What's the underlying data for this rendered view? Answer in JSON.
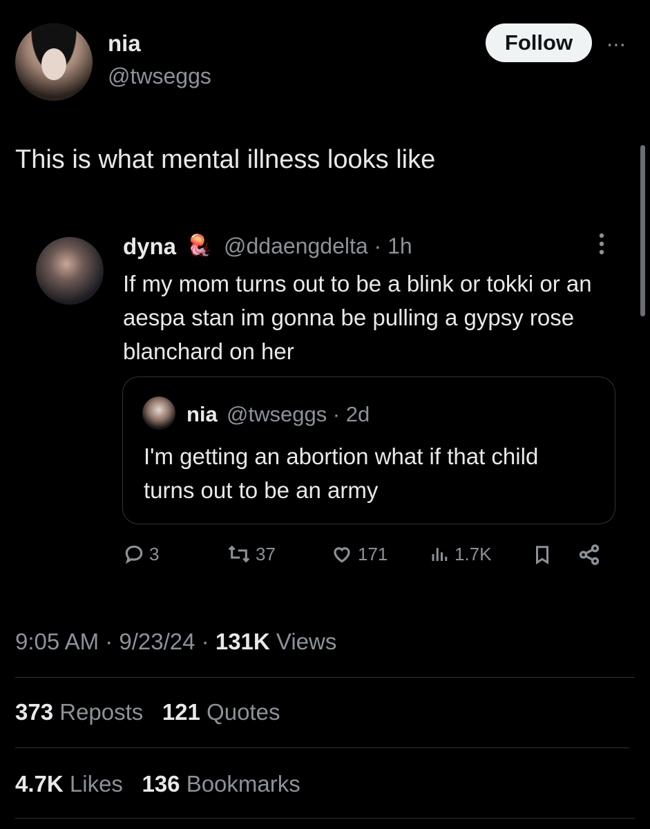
{
  "author": {
    "name": "nia",
    "handle": "@twseggs",
    "follow_label": "Follow",
    "more_label": "⋯"
  },
  "tweet": {
    "text": "This is what mental illness looks like"
  },
  "quoted": {
    "name": "dyna",
    "emoji": "🪼",
    "handle_time": "@ddaengdelta · 1h",
    "text": "If my mom turns out to be a blink or tokki or an aespa stan im gonna be pulling a gypsy rose blanchard on her",
    "nested": {
      "name": "nia",
      "handle_time": "@twseggs · 2d",
      "text": "I'm getting an abortion what if that child turns out to be an army"
    },
    "actions": {
      "replies": "3",
      "reposts": "37",
      "likes": "171",
      "views": "1.7K"
    }
  },
  "meta": {
    "time": "9:05 AM",
    "date": "9/23/24",
    "views_count": "131K",
    "views_label": "Views"
  },
  "stats": {
    "reposts_count": "373",
    "reposts_label": "Reposts",
    "quotes_count": "121",
    "quotes_label": "Quotes",
    "likes_count": "4.7K",
    "likes_label": "Likes",
    "bookmarks_count": "136",
    "bookmarks_label": "Bookmarks"
  },
  "icons": [
    "reply-icon",
    "repost-icon",
    "like-icon",
    "views-icon",
    "bookmark-icon",
    "share-icon",
    "more-icon"
  ]
}
